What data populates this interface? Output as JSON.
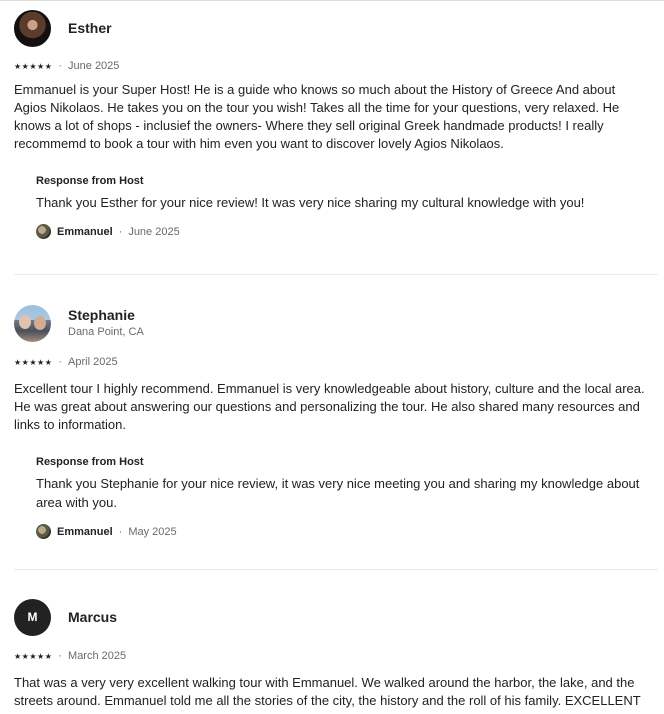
{
  "reviews": [
    {
      "name": "Esther",
      "location": "",
      "stars": "★★★★★",
      "date": "June 2025",
      "text": "Emmanuel is your Super Host! He is a guide who knows so much about the History of Greece And about Agios Nikolaos. He takes you on the tour you wish! Takes all the time for your questions, very relaxed. He knows a lot of shops - inclusief the owners- Where they sell original Greek handmade products! I really recommemd to book a tour with him even you want to discover lovely Agios Nikolaos.",
      "response_title": "Response from Host",
      "response_text": "Thank you Esther for your nice review! It was very nice sharing my cultural knowledge with you!",
      "host_name": "Emmanuel",
      "response_date": "June 2025"
    },
    {
      "name": "Stephanie",
      "location": "Dana Point, CA",
      "stars": "★★★★★",
      "date": "April 2025",
      "text": "Excellent tour I highly recommend. Emmanuel is very knowledgeable about history, culture and the local area. He was great about answering our questions and personalizing the tour. He also shared many resources and links to information.",
      "response_title": "Response from Host",
      "response_text": "Thank you Stephanie for your nice review, it was very nice meeting you and sharing my knowledge about area with you.",
      "host_name": "Emmanuel",
      "response_date": "May 2025"
    },
    {
      "name": "Marcus",
      "avatar_letter": "M",
      "location": "",
      "stars": "★★★★★",
      "date": "March 2025",
      "text": "That was a very very excellent walking tour with Emmanuel. We walked around the harbor, the lake, and the streets around. Emmanuel told me all the stories of the city, the history and the roll of his family. EXCELLENT"
    }
  ],
  "separator": "·"
}
